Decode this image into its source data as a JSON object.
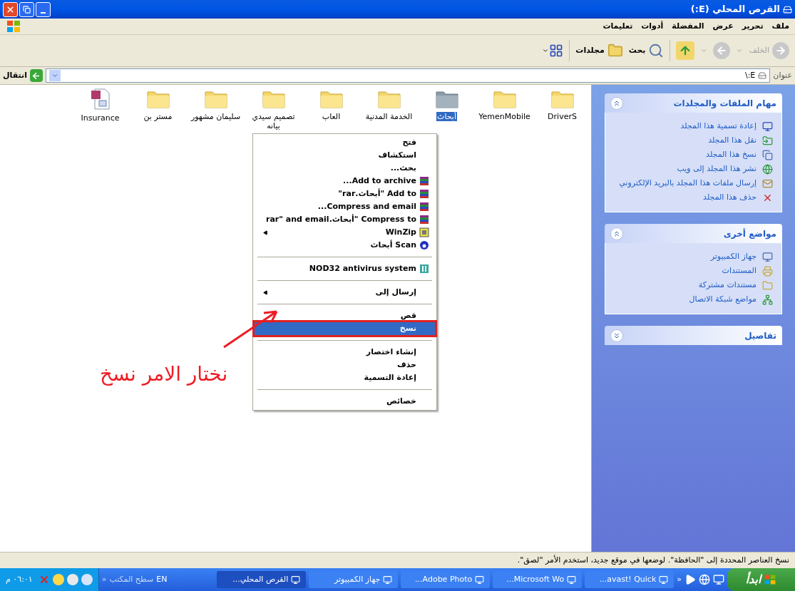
{
  "window": {
    "title": "القرص المحلي (E:)"
  },
  "menu_bar": [
    "ملف",
    "تحرير",
    "عرض",
    "المفضلة",
    "أدوات",
    "تعليمات"
  ],
  "toolbar": {
    "back": {
      "label": "الخلف",
      "disabled": true
    },
    "forward": {
      "disabled": true
    },
    "search": "بحث",
    "folders": "مجلدات"
  },
  "address_bar": {
    "label": "عنوان",
    "value": "E:\\",
    "go": "انتقال"
  },
  "task_panel": [
    {
      "title": "مهام الملفات والمجلدات",
      "expanded": true,
      "items": [
        {
          "kind": "rename",
          "label": "إعادة تسمية هذا المجلد"
        },
        {
          "kind": "move",
          "label": "نقل هذا المجلد"
        },
        {
          "kind": "copy",
          "label": "نسخ هذا المجلد"
        },
        {
          "kind": "publish",
          "label": "نشر هذا المجلد إلى ويب"
        },
        {
          "kind": "email",
          "label": "إرسال ملفات هذا المجلد بالبريد الإلكتروني"
        },
        {
          "kind": "delete",
          "label": "حذف هذا المجلد"
        }
      ]
    },
    {
      "title": "مواضع أخرى",
      "expanded": true,
      "items": [
        {
          "kind": "computer",
          "label": "جهاز الكمبيوتر"
        },
        {
          "kind": "documents",
          "label": "المستندات"
        },
        {
          "kind": "shared",
          "label": "مستندات مشتركة"
        },
        {
          "kind": "network",
          "label": "مواضع شبكة الاتصال"
        }
      ]
    },
    {
      "title": "تفاصيل",
      "expanded": false
    }
  ],
  "files": [
    {
      "kind": "folder",
      "name": "DriverS",
      "selected": false
    },
    {
      "kind": "folder",
      "name": "YemenMobile",
      "selected": false
    },
    {
      "kind": "folder",
      "name": "أبحاث",
      "selected": true
    },
    {
      "kind": "folder",
      "name": "الخدمة المدنية",
      "selected": false
    },
    {
      "kind": "folder",
      "name": "العاب",
      "selected": false
    },
    {
      "kind": "folder",
      "name": "تصميم سيدي بيانه",
      "selected": false
    },
    {
      "kind": "folder",
      "name": "سليمان مشهور",
      "selected": false
    },
    {
      "kind": "folder",
      "name": "مستر بن",
      "selected": false
    },
    {
      "kind": "document",
      "name": "Insurance",
      "selected": false
    }
  ],
  "context_menu": {
    "items": [
      {
        "kind": "plain",
        "label": "فتح",
        "submenu": false,
        "selected": false
      },
      {
        "kind": "plain",
        "label": "استكشاف",
        "submenu": false,
        "selected": false
      },
      {
        "kind": "plain",
        "label": "بحث...",
        "submenu": false,
        "selected": false
      },
      {
        "kind": "archive",
        "label": "Add to archive...",
        "submenu": false,
        "selected": false
      },
      {
        "kind": "archive",
        "label": "Add to \"أبحاث.rar\"",
        "submenu": false,
        "selected": false
      },
      {
        "kind": "archive",
        "label": "Compress and email...",
        "submenu": false,
        "selected": false
      },
      {
        "kind": "archive",
        "label": "Compress to \"أبحاث.rar\" and email",
        "submenu": false,
        "selected": false
      },
      {
        "kind": "winzip",
        "label": "WinZip",
        "submenu": true,
        "selected": false
      },
      {
        "kind": "scan",
        "label": "Scan أبحاث",
        "submenu": false,
        "selected": false
      },
      {
        "kind": "separator"
      },
      {
        "kind": "antivirus",
        "label": "NOD32 antivirus system",
        "submenu": false,
        "selected": false
      },
      {
        "kind": "separator"
      },
      {
        "kind": "plain",
        "label": "إرسال إلى",
        "submenu": true,
        "selected": false
      },
      {
        "kind": "separator"
      },
      {
        "kind": "plain",
        "label": "قص",
        "submenu": false,
        "selected": false
      },
      {
        "kind": "plain",
        "label": "نسخ",
        "submenu": false,
        "selected": true
      },
      {
        "kind": "separator"
      },
      {
        "kind": "plain",
        "label": "إنشاء اختصار",
        "submenu": false,
        "selected": false
      },
      {
        "kind": "plain",
        "label": "حذف",
        "submenu": false,
        "selected": false
      },
      {
        "kind": "plain",
        "label": "إعادة التسمية",
        "submenu": false,
        "selected": false
      },
      {
        "kind": "separator"
      },
      {
        "kind": "plain",
        "label": "خصائص",
        "submenu": false,
        "selected": false
      }
    ]
  },
  "annotation": "نختار الامر نسخ",
  "status_bar": "نسخ العناصر المحددة إلى \"الحافظة\". لوضعها في موقع جديد، استخدم الأمر \"لصق\".",
  "taskbar": {
    "start": "ابدأ",
    "quick_launch_chevron": "«",
    "tasks": [
      {
        "label": "avast! Quick...",
        "selected": false
      },
      {
        "label": "Microsoft Wo...",
        "selected": false
      },
      {
        "label": "Adobe Photo...",
        "selected": false
      },
      {
        "label": "جهاز الكمبيوتر",
        "selected": false
      },
      {
        "label": "القرص المحلي...",
        "selected": true
      }
    ],
    "language": "EN",
    "desktop": "سطح المكتب",
    "desktop_chevron": "«",
    "clock": "٠٦:٠١ م"
  }
}
